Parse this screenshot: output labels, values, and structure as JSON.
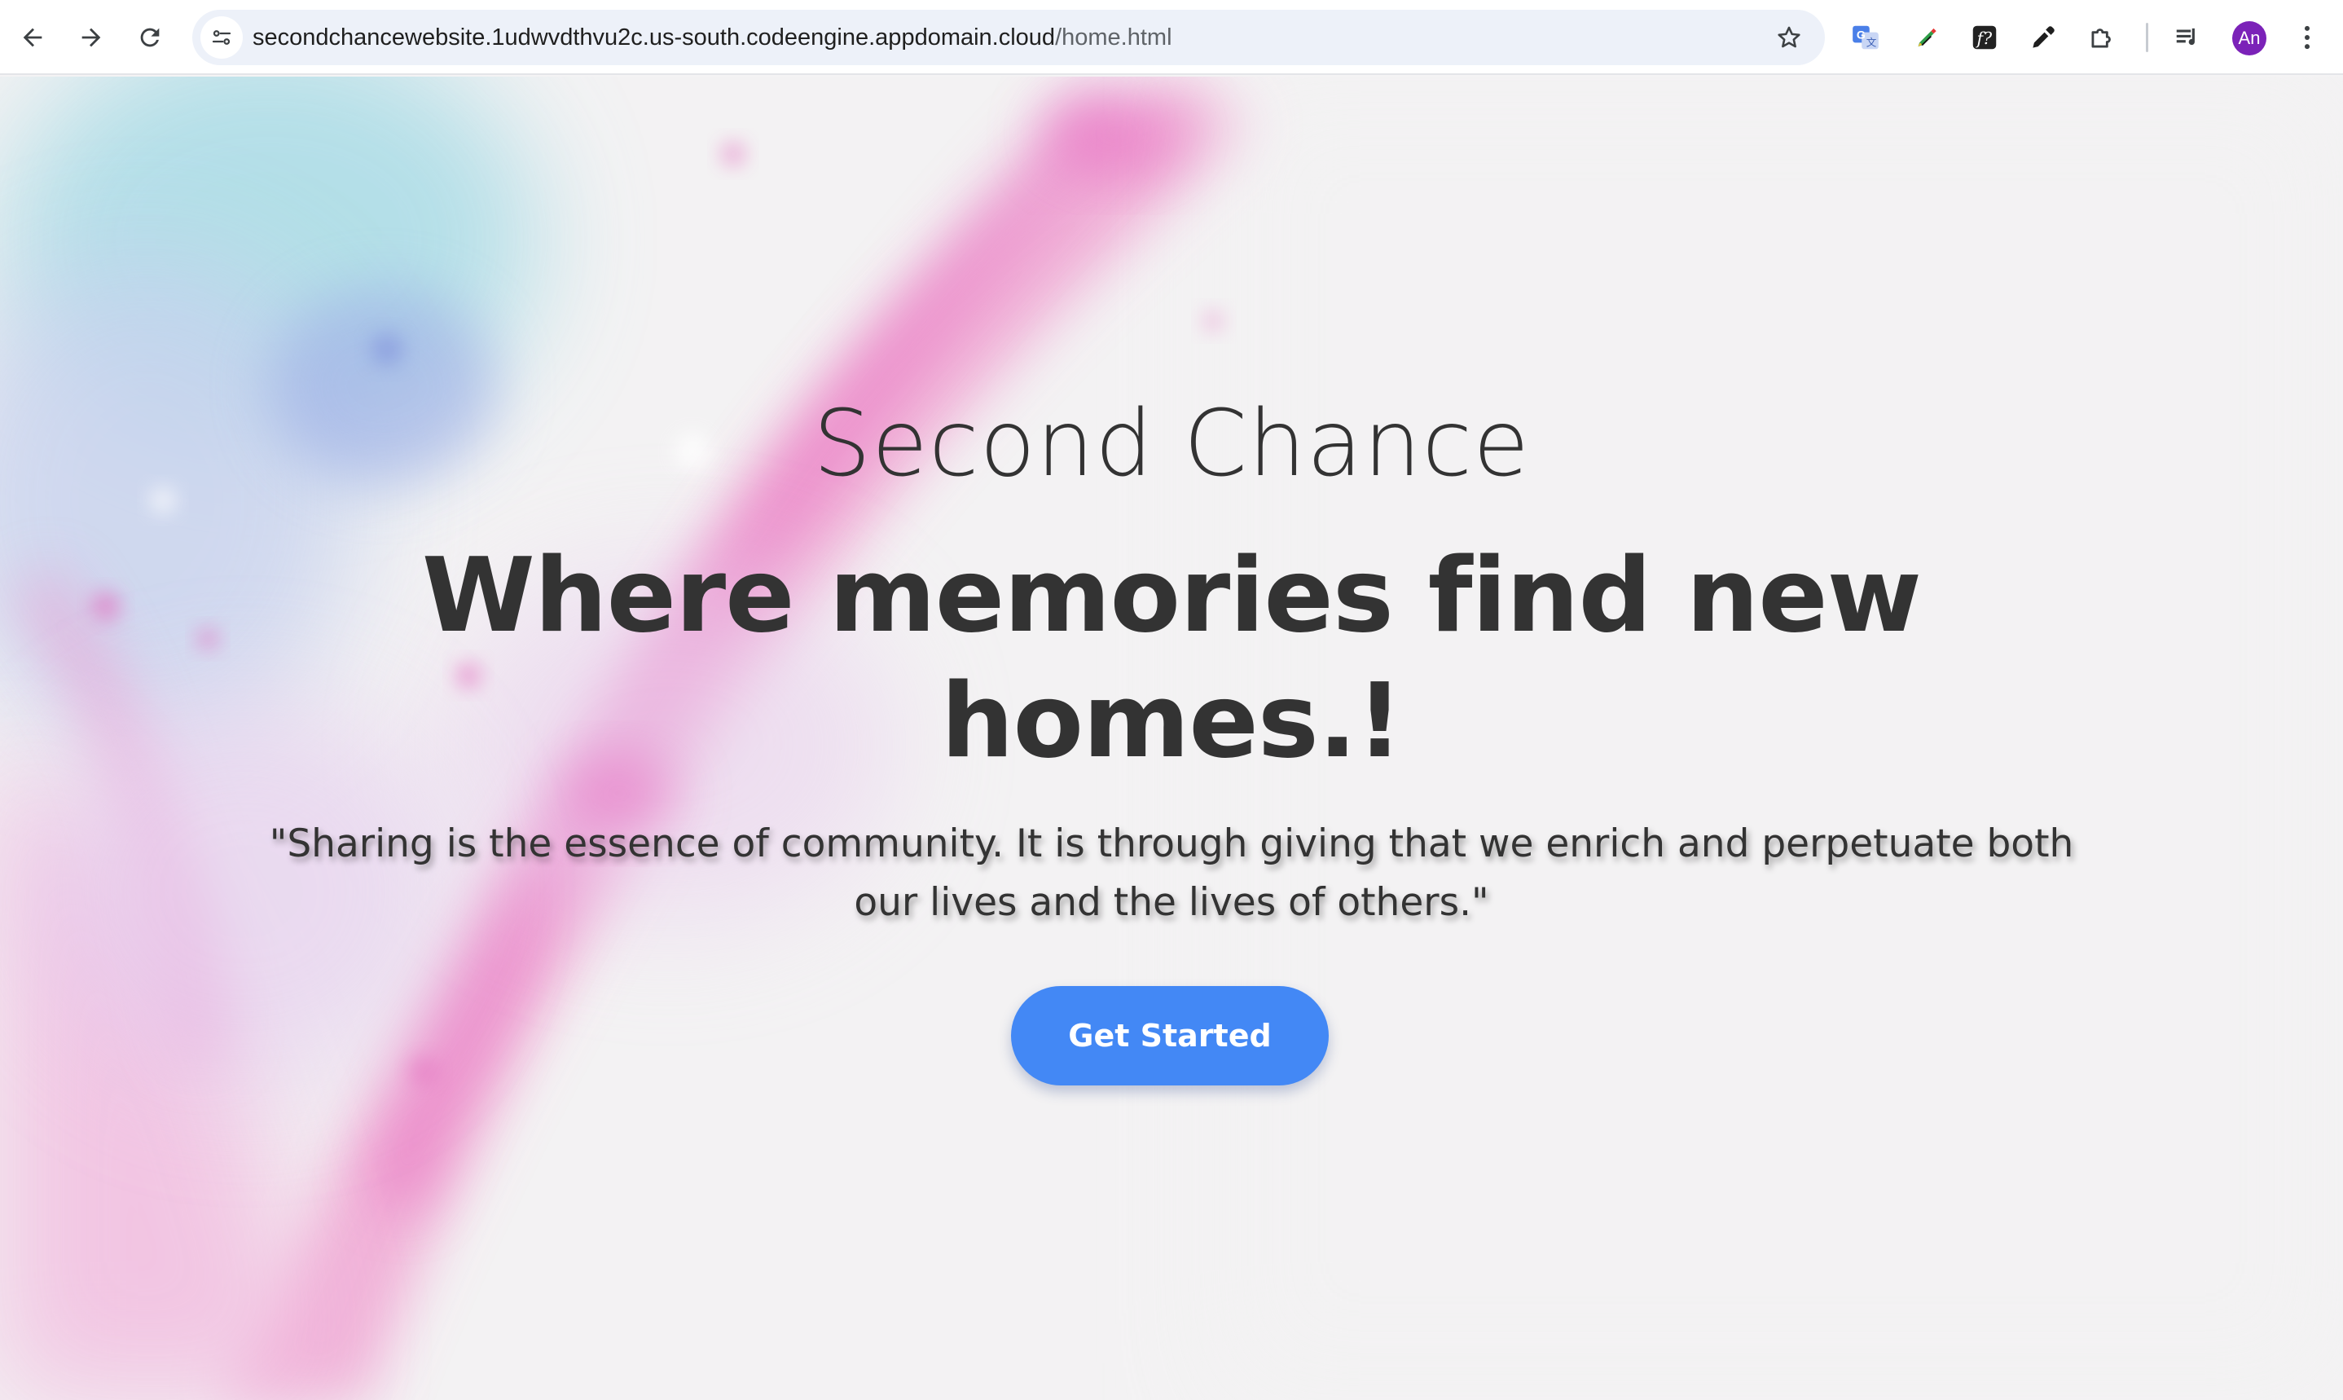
{
  "browser": {
    "url_host": "secondchancewebsite.1udwvdthvu2c.us-south.codeengine.appdomain.cloud",
    "url_path": "/home.html",
    "profile_initials": "An",
    "icons": {
      "back": "back-arrow-icon",
      "forward": "forward-arrow-icon",
      "reload": "reload-icon",
      "site_info": "site-info-icon",
      "bookmark": "star-icon",
      "translate": "google-translate-icon",
      "extension_1": "color-pen-extension-icon",
      "extension_2": "font-finder-extension-icon",
      "extension_3": "eyedropper-extension-icon",
      "extensions": "puzzle-extensions-icon",
      "media": "media-queue-icon",
      "menu": "kebab-menu-icon"
    }
  },
  "hero": {
    "site_name": "Second Chance",
    "tagline": "Where memories find new homes.!",
    "quote": "\"Sharing is the essence of community. It is through giving that we enrich and perpetuate both our lives and the lives of others.\"",
    "cta_label": "Get Started"
  },
  "colors": {
    "accent": "#4388f5",
    "text": "#333333",
    "background": "#f3f2f3",
    "avatar": "#7b22b8"
  }
}
